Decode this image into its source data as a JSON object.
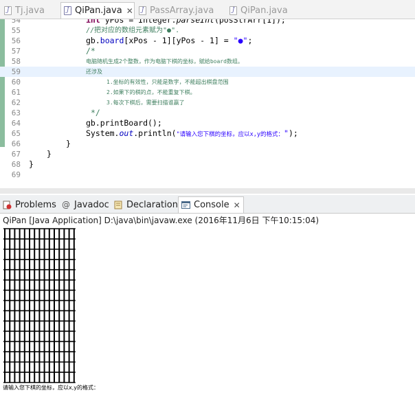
{
  "editor_tabs": [
    {
      "label": "Tj.java",
      "active": false
    },
    {
      "label": "QiPan.java",
      "active": true
    },
    {
      "label": "PassArray.java",
      "active": false
    },
    {
      "label": "QiPan.java",
      "active": false
    }
  ],
  "close_glyph": "✕",
  "code_lines": [
    {
      "num": "54",
      "text": "int yPos = Integer.parseInt(posStrArr[1]);"
    },
    {
      "num": "55",
      "text": "//把对应的数组元素赋为\"●\"."
    },
    {
      "num": "56",
      "text": "gb.board[xPos - 1][yPos - 1] = \"●\";"
    },
    {
      "num": "57",
      "text": "/*"
    },
    {
      "num": "58",
      "text": "电脑随机生成2个整数，作为电脑下棋的坐标，赋给board数组。"
    },
    {
      "num": "59",
      "text": "还涉及"
    },
    {
      "num": "60",
      "text": "1.坐标的有效性，只能是数字，不能超出棋盘范围"
    },
    {
      "num": "61",
      "text": "2.如果下的棋的点，不能重复下棋。"
    },
    {
      "num": "62",
      "text": "3.每次下棋后，需要扫描谁赢了"
    },
    {
      "num": "63",
      "text": "*/"
    },
    {
      "num": "64",
      "text": "gb.printBoard();"
    },
    {
      "num": "65",
      "text": "System.out.println(\"请输入您下棋的坐标，应以x,y的格式：\");"
    },
    {
      "num": "66",
      "text": "}"
    },
    {
      "num": "67",
      "text": "}"
    },
    {
      "num": "68",
      "text": "}"
    },
    {
      "num": "69",
      "text": ""
    }
  ],
  "view_tabs": [
    {
      "label": "Problems"
    },
    {
      "label": "Javadoc"
    },
    {
      "label": "Declaration"
    },
    {
      "label": "Console",
      "active": true
    }
  ],
  "console": {
    "title": "QiPan [Java Application] D:\\java\\bin\\javaw.exe (2016年11月6日 下午10:15:04)",
    "prompt": "请输入您下棋的坐标，应以x,y的格式：",
    "board_size": 15
  },
  "colors": {
    "keyword": "#7f0055",
    "comment": "#3f7f5f",
    "field": "#0000c0",
    "string": "#2a00ff",
    "highlight_line": "#e8f2fe",
    "change_marker": "#8bbd9e"
  }
}
